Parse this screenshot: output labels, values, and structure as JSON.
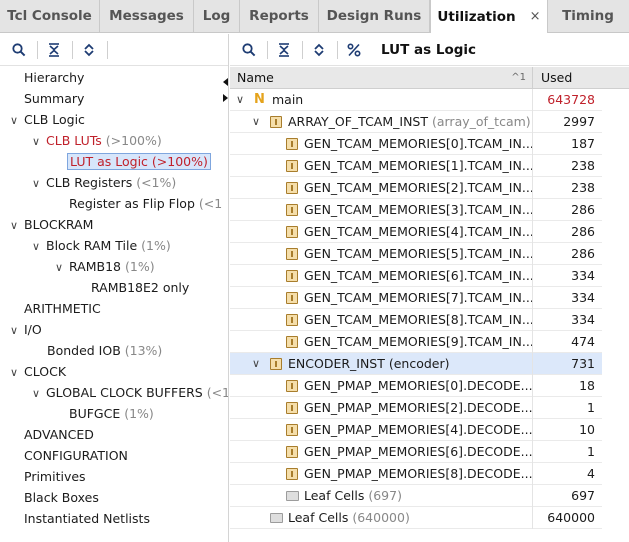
{
  "tabs": [
    {
      "label": "Tcl Console"
    },
    {
      "label": "Messages"
    },
    {
      "label": "Log"
    },
    {
      "label": "Reports"
    },
    {
      "label": "Design Runs"
    },
    {
      "label": "Utilization",
      "close": "×"
    },
    {
      "label": "Timing"
    }
  ],
  "left_toolbar": {
    "icons": [
      "search-icon",
      "collapse-all-icon",
      "expand-all-icon"
    ]
  },
  "left_tree": [
    {
      "label": "Hierarchy",
      "pct": ""
    },
    {
      "label": "Summary",
      "pct": ""
    },
    {
      "label": "CLB Logic",
      "pct": "",
      "chevron": "∨"
    },
    {
      "label": "CLB LUTs",
      "pct": "(>100%)",
      "chevron": "∨"
    },
    {
      "label": "LUT as Logic (>100%)",
      "pct": ""
    },
    {
      "label": "CLB Registers",
      "pct": "(<1%)",
      "chevron": "∨"
    },
    {
      "label": "Register as Flip Flop",
      "pct": "(<1"
    },
    {
      "label": "BLOCKRAM",
      "pct": "",
      "chevron": "∨"
    },
    {
      "label": "Block RAM Tile",
      "pct": "(1%)",
      "chevron": "∨"
    },
    {
      "label": "RAMB18",
      "pct": "(1%)",
      "chevron": "∨"
    },
    {
      "label": "RAMB18E2 only",
      "pct": ""
    },
    {
      "label": "ARITHMETIC",
      "pct": ""
    },
    {
      "label": "I/O",
      "pct": "",
      "chevron": "∨"
    },
    {
      "label": "Bonded IOB",
      "pct": "(13%)"
    },
    {
      "label": "CLOCK",
      "pct": "",
      "chevron": "∨"
    },
    {
      "label": "GLOBAL CLOCK BUFFERS",
      "pct": "(<1°",
      "chevron": "∨"
    },
    {
      "label": "BUFGCE",
      "pct": "(1%)"
    },
    {
      "label": "ADVANCED",
      "pct": ""
    },
    {
      "label": "CONFIGURATION",
      "pct": ""
    },
    {
      "label": "Primitives",
      "pct": ""
    },
    {
      "label": "Black Boxes",
      "pct": ""
    },
    {
      "label": "Instantiated Netlists",
      "pct": ""
    }
  ],
  "right_toolbar": {
    "icons": [
      "search-icon",
      "collapse-all-icon",
      "expand-all-icon",
      "percent-icon"
    ],
    "title": "LUT as Logic"
  },
  "table": {
    "columns": {
      "name": "Name",
      "used": "Used",
      "sort_indicator": "^1"
    },
    "rows": [
      {
        "name": "main",
        "sub": "",
        "used": "643728",
        "chevron": "∨"
      },
      {
        "name": "ARRAY_OF_TCAM_INST",
        "sub": "(array_of_tcam)",
        "used": "2997",
        "chevron": "∨"
      },
      {
        "name": "GEN_TCAM_MEMORIES[0].TCAM_IN...",
        "sub": "",
        "used": "187"
      },
      {
        "name": "GEN_TCAM_MEMORIES[1].TCAM_IN...",
        "sub": "",
        "used": "238"
      },
      {
        "name": "GEN_TCAM_MEMORIES[2].TCAM_IN...",
        "sub": "",
        "used": "238"
      },
      {
        "name": "GEN_TCAM_MEMORIES[3].TCAM_IN...",
        "sub": "",
        "used": "286"
      },
      {
        "name": "GEN_TCAM_MEMORIES[4].TCAM_IN...",
        "sub": "",
        "used": "286"
      },
      {
        "name": "GEN_TCAM_MEMORIES[5].TCAM_IN...",
        "sub": "",
        "used": "286"
      },
      {
        "name": "GEN_TCAM_MEMORIES[6].TCAM_IN...",
        "sub": "",
        "used": "334"
      },
      {
        "name": "GEN_TCAM_MEMORIES[7].TCAM_IN...",
        "sub": "",
        "used": "334"
      },
      {
        "name": "GEN_TCAM_MEMORIES[8].TCAM_IN...",
        "sub": "",
        "used": "334"
      },
      {
        "name": "GEN_TCAM_MEMORIES[9].TCAM_IN...",
        "sub": "",
        "used": "474"
      },
      {
        "name": "ENCODER_INST (encoder)",
        "sub": "",
        "used": "731",
        "chevron": "∨"
      },
      {
        "name": "GEN_PMAP_MEMORIES[0].DECODE...",
        "sub": "",
        "used": "18"
      },
      {
        "name": "GEN_PMAP_MEMORIES[2].DECODE...",
        "sub": "",
        "used": "1"
      },
      {
        "name": "GEN_PMAP_MEMORIES[4].DECODE...",
        "sub": "",
        "used": "10"
      },
      {
        "name": "GEN_PMAP_MEMORIES[6].DECODE...",
        "sub": "",
        "used": "1"
      },
      {
        "name": "GEN_PMAP_MEMORIES[8].DECODE...",
        "sub": "",
        "used": "4"
      },
      {
        "name": "Leaf Cells",
        "sub": "(697)",
        "used": "697"
      },
      {
        "name": "Leaf Cells",
        "sub": "(640000)",
        "used": "640000"
      }
    ]
  },
  "colors": {
    "accent_red": "#c0212b",
    "selection": "#dce8fa",
    "icon_blue": "#1e3c73"
  }
}
